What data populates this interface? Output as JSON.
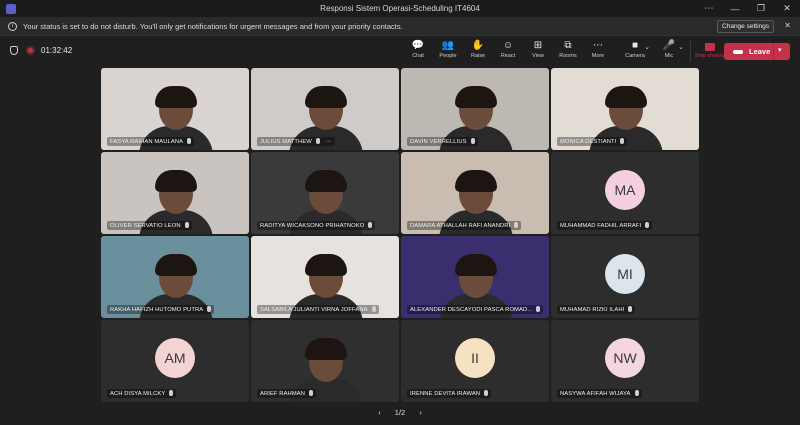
{
  "window": {
    "title": "Responsi Sistem Operasi-Scheduling IT4604",
    "controls": [
      "⋯",
      "—",
      "❐",
      "✕"
    ]
  },
  "notification": {
    "message": "Your status is set to do not disturb. You'll only get notifications for urgent messages and from your priority contacts.",
    "button": "Change settings",
    "close": "✕"
  },
  "toolbar": {
    "timer": "01:32:42",
    "items": [
      {
        "label": "Chat",
        "icon": "chat-icon",
        "glyph": "💬"
      },
      {
        "label": "People",
        "icon": "people-icon",
        "glyph": "👥",
        "count": "19"
      },
      {
        "label": "Raise",
        "icon": "hand-icon",
        "glyph": "✋"
      },
      {
        "label": "React",
        "icon": "react-icon",
        "glyph": "☺"
      },
      {
        "label": "View",
        "icon": "view-icon",
        "glyph": "⊞"
      },
      {
        "label": "Rooms",
        "icon": "rooms-icon",
        "glyph": "⧉"
      },
      {
        "label": "More",
        "icon": "more-icon",
        "glyph": "⋯"
      }
    ],
    "media": [
      {
        "label": "Camera",
        "icon": "camera-icon",
        "glyph": "■"
      },
      {
        "label": "Mic",
        "icon": "mic-icon",
        "glyph": "🎤"
      },
      {
        "label": "Stop sharing",
        "icon": "share-icon",
        "glyph": ""
      }
    ],
    "leave": "Leave"
  },
  "participants": [
    {
      "name": "FASYA RAIHAN MAULANA",
      "type": "video",
      "bg": "#d9d4cf"
    },
    {
      "name": "JULIUS MATTHEW",
      "type": "video",
      "bg": "#cfcbc8",
      "more": "⋯"
    },
    {
      "name": "DAVIN VERRELLIUS",
      "type": "video",
      "bg": "#bdb8b2"
    },
    {
      "name": "MONICA DESTIANTI",
      "type": "video",
      "bg": "#e2dcd4"
    },
    {
      "name": "OLIVER SERVATIO LEON",
      "type": "video",
      "bg": "#c9c4bf"
    },
    {
      "name": "RADITYA WICAKSONO PRIHATNOKO",
      "type": "video",
      "bg": "#3a3a3a"
    },
    {
      "name": "DAMARA ATHALLAH RAFI ANANDRI",
      "type": "video",
      "bg": "#c8bdb0"
    },
    {
      "name": "MUHAMMAD FADHIL ARRAFI",
      "type": "avatar",
      "initials": "MA",
      "avatar_color": "#f3cfe0"
    },
    {
      "name": "RAKHA HAFIZH HUTOMO PUTRA",
      "type": "video",
      "bg": "#6a8f9d"
    },
    {
      "name": "SALSABILA JULIANTI VIRNA JOFFANA",
      "type": "video",
      "bg": "#e6e2de"
    },
    {
      "name": "ALEXANDER DESCAYODI PASCA ROMAD...",
      "type": "video",
      "bg": "#3b2e6e"
    },
    {
      "name": "MUHAMAD RIZKI ILAHI",
      "type": "avatar",
      "initials": "MI",
      "avatar_color": "#dbe5ec"
    },
    {
      "name": "ACH DISYA MILCKY",
      "type": "avatar",
      "initials": "AM",
      "avatar_color": "#f3d3d3"
    },
    {
      "name": "ARIEF RAHMAN",
      "type": "video",
      "bg": "#2f2f2f"
    },
    {
      "name": "IRENNE DEVITA IRAWAN",
      "type": "avatar",
      "initials": "II",
      "avatar_color": "#f6e2c2"
    },
    {
      "name": "NASYWA AFIFAH WIJAYA",
      "type": "avatar",
      "initials": "NW",
      "avatar_color": "#f3d6df"
    }
  ],
  "pager": {
    "prev": "‹",
    "label": "1/2",
    "next": "›"
  }
}
